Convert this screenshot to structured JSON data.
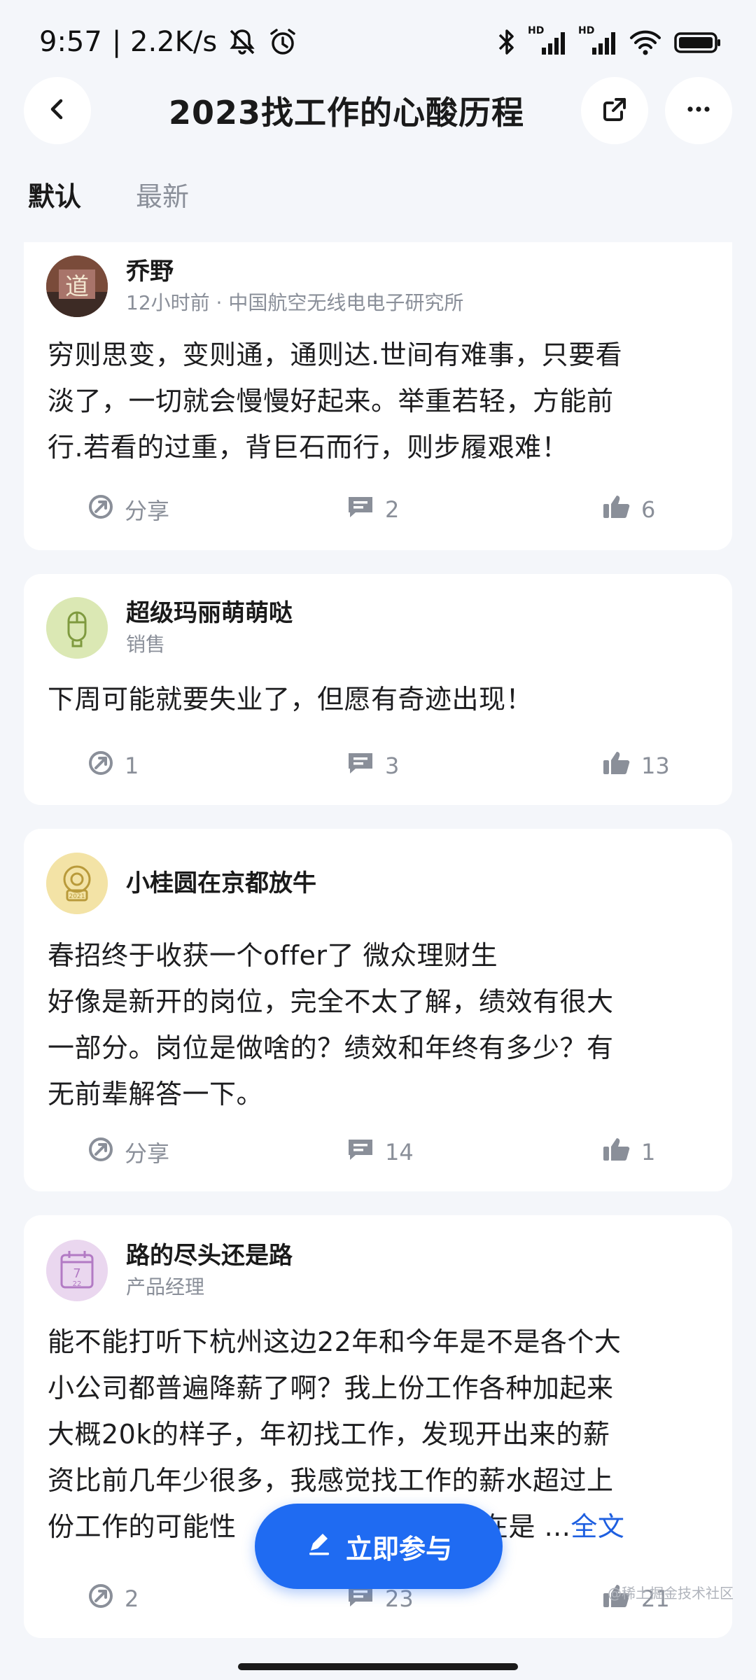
{
  "status_bar": {
    "time": "9:57",
    "net_speed": "| 2.2K/s",
    "hd1": "HD",
    "hd2": "HD"
  },
  "header": {
    "title": "2023找工作的心酸历程"
  },
  "tabs": [
    {
      "label": "默认",
      "active": true
    },
    {
      "label": "最新",
      "active": false
    }
  ],
  "posts": [
    {
      "name": "乔野",
      "meta": "12小时前 · 中国航空无线电电子研究所",
      "lines": [
        "穷则思变，变则通，通则达.世间有难事，只要看",
        "淡了，一切就会慢慢好起来。举重若轻，方能前",
        "行.若看的过重，背巨石而行，则步履艰难！"
      ],
      "share": "分享",
      "comments": "2",
      "likes": "6"
    },
    {
      "name": "超级玛丽萌萌哒",
      "meta": "销售",
      "lines": [
        "下周可能就要失业了，但愿有奇迹出现！"
      ],
      "share": "1",
      "comments": "3",
      "likes": "13"
    },
    {
      "name": "小桂圆在京都放牛",
      "meta": "",
      "lines": [
        "春招终于收获一个offer了 微众理财生",
        "好像是新开的岗位，完全不太了解，绩效有很大",
        "一部分。岗位是做啥的？绩效和年终有多少？有",
        "无前辈解答一下。"
      ],
      "share": "分享",
      "comments": "14",
      "likes": "1"
    },
    {
      "name": "路的尽头还是路",
      "meta": "产品经理",
      "lines": [
        "能不能打听下杭州这边22年和今年是不是各个大",
        "小公司都普遍降薪了啊？我上份工作各种加起来",
        "大概20k的样子，年初找工作，发现开出来的薪",
        "资比前几年少很多，我感觉找工作的薪水超过上",
        "份工作的可能性"
      ],
      "line5_tail": "在是 ...",
      "full_link": "全文",
      "share": "2",
      "comments": "23",
      "likes": "21"
    }
  ],
  "avatars": {
    "post1_glyph": "道",
    "post3_badge": "2021",
    "post4_day_top": "7",
    "post4_day_bottom": "22"
  },
  "fab": {
    "label": "立即参与"
  },
  "watermark": "@稀土掘金技术社区",
  "colors": {
    "accent": "#1f6bf2",
    "link": "#1e5fe0",
    "background": "#f4f6fa"
  }
}
